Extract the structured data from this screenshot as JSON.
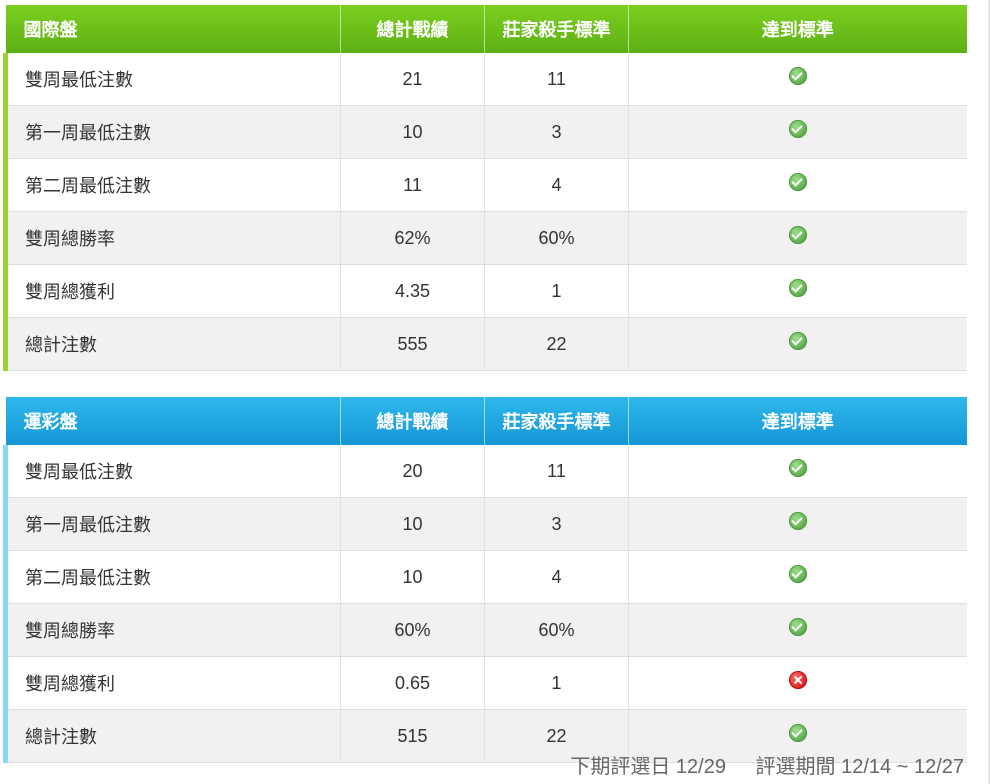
{
  "international": {
    "headers": [
      "國際盤",
      "總計戰績",
      "莊家殺手標準",
      "達到標準"
    ],
    "rows": [
      {
        "label": "雙周最低注數",
        "total": "21",
        "standard": "11",
        "status": "ok"
      },
      {
        "label": "第一周最低注數",
        "total": "10",
        "standard": "3",
        "status": "ok"
      },
      {
        "label": "第二周最低注數",
        "total": "11",
        "standard": "4",
        "status": "ok"
      },
      {
        "label": "雙周總勝率",
        "total": "62%",
        "standard": "60%",
        "status": "ok"
      },
      {
        "label": "雙周總獲利",
        "total": "4.35",
        "standard": "1",
        "status": "ok"
      },
      {
        "label": "總計注數",
        "total": "555",
        "standard": "22",
        "status": "ok"
      }
    ]
  },
  "lottery": {
    "headers": [
      "運彩盤",
      "總計戰績",
      "莊家殺手標準",
      "達到標準"
    ],
    "rows": [
      {
        "label": "雙周最低注數",
        "total": "20",
        "standard": "11",
        "status": "ok"
      },
      {
        "label": "第一周最低注數",
        "total": "10",
        "standard": "3",
        "status": "ok"
      },
      {
        "label": "第二周最低注數",
        "total": "10",
        "standard": "4",
        "status": "ok"
      },
      {
        "label": "雙周總勝率",
        "total": "60%",
        "standard": "60%",
        "status": "ok"
      },
      {
        "label": "雙周總獲利",
        "total": "0.65",
        "standard": "1",
        "status": "fail"
      },
      {
        "label": "總計注數",
        "total": "515",
        "standard": "22",
        "status": "ok"
      }
    ]
  },
  "footer": {
    "next_selection": "下期評選日 12/29",
    "selection_period": "評選期間 12/14 ~ 12/27"
  },
  "colors": {
    "green_header": "#5db014",
    "blue_header": "#1596d6",
    "ok_icon": "#5aa84b",
    "fail_icon": "#d81c1c"
  },
  "icons": {
    "ok": "check-circle-icon",
    "fail": "x-circle-icon"
  }
}
